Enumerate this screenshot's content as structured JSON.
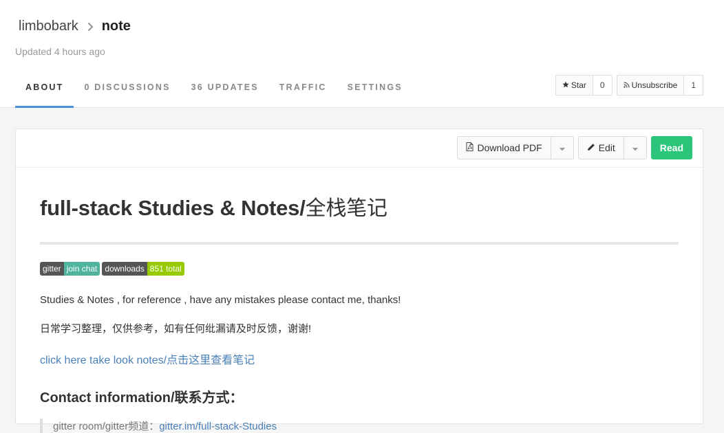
{
  "header": {
    "owner": "limbobark",
    "repo": "note",
    "updated": "Updated 4 hours ago"
  },
  "tabs": [
    {
      "label": "ABOUT",
      "active": true
    },
    {
      "label": "0 DISCUSSIONS"
    },
    {
      "label": "36 UPDATES"
    },
    {
      "label": "TRAFFIC"
    },
    {
      "label": "SETTINGS"
    }
  ],
  "repo_buttons": {
    "star_label": "Star",
    "star_count": "0",
    "unsubscribe_label": "Unsubscribe",
    "unsubscribe_count": "1"
  },
  "actions": {
    "download_pdf": "Download PDF",
    "edit": "Edit",
    "read": "Read"
  },
  "content": {
    "title": "full-stack Studies & Notes/",
    "title_cjk": "全栈笔记",
    "badges": [
      {
        "left": "gitter",
        "right": "join chat",
        "color": "#4eb49b"
      },
      {
        "left": "downloads",
        "right": "851 total",
        "color": "#97ca00"
      }
    ],
    "para1": "Studies & Notes , for reference , have any mistakes please contact me, thanks!",
    "para2": "日常学习整理，仅供参考，如有任何纰漏请及时反馈，谢谢!",
    "link": "click here take look notes/点击这里查看笔记",
    "contact_heading": "Contact information/",
    "contact_heading_cjk": "联系方式：",
    "quote_prefix": "gitter room/gitter频道：",
    "quote_link": "gitter.im/full-stack-Studies"
  },
  "colors": {
    "accent": "#4a90d9",
    "read_button": "#2bc679",
    "link": "#4a80b8"
  }
}
